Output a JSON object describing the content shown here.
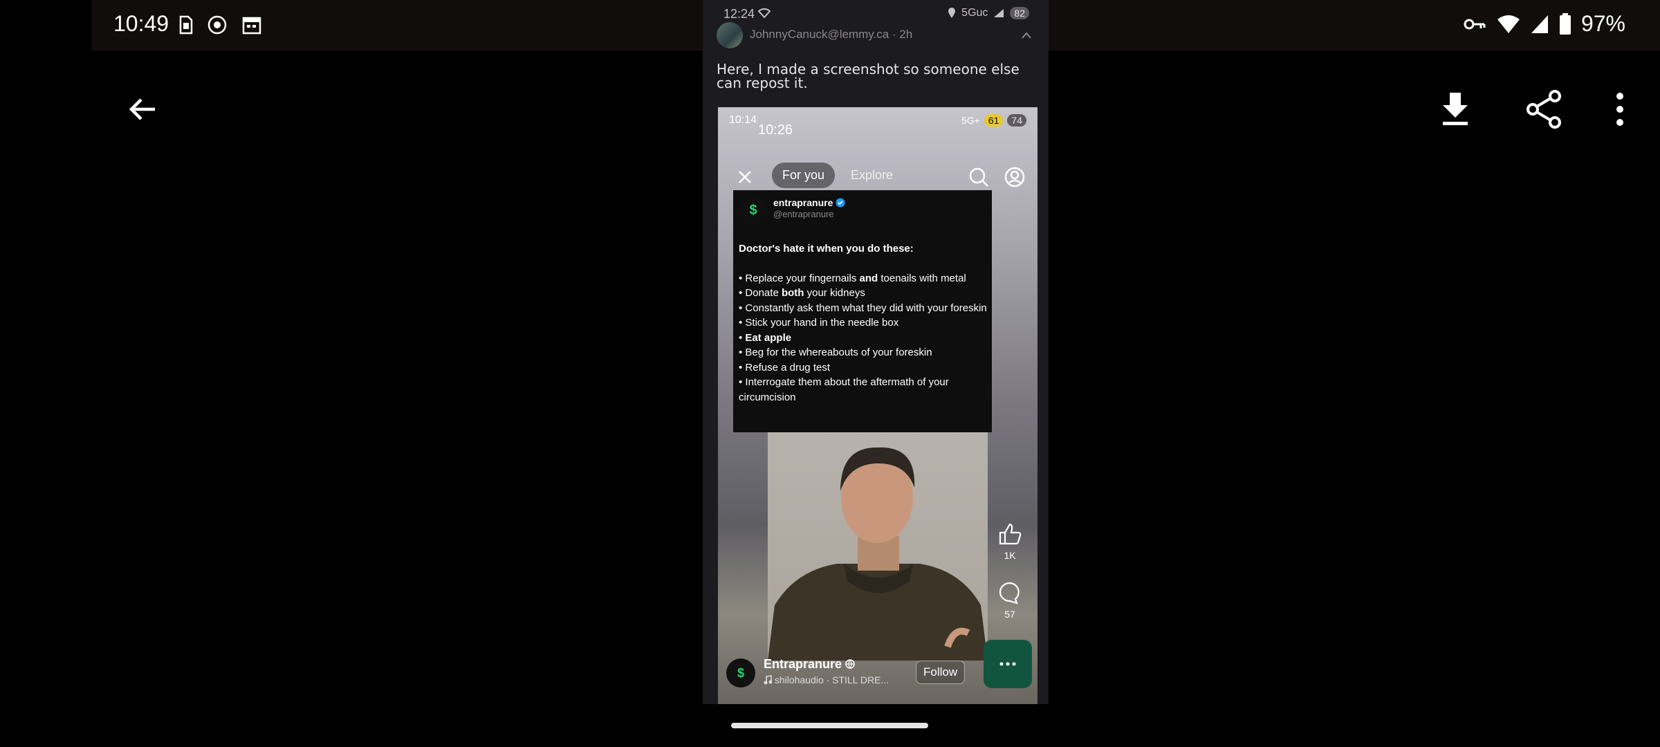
{
  "outer_status": {
    "time": "10:49",
    "battery": "97%",
    "icons": [
      "sim-card-icon",
      "vpn-globe-icon",
      "calendar-icon",
      "key-icon",
      "wifi-icon",
      "signal-icon",
      "battery-icon"
    ]
  },
  "toolbar": {
    "back_icon": "arrow-left-icon",
    "download_icon": "download-icon",
    "share_icon": "share-icon",
    "more_icon": "more-vert-icon"
  },
  "image": {
    "inner_status": {
      "time": "12:24",
      "network": "5Guc",
      "battery_badge": "82"
    },
    "comment": {
      "author": "JohnnyCanuck@lemmy.ca",
      "age": "2h",
      "text": "Here, I made a screenshot so someone else can repost it."
    },
    "phone": {
      "status_time": "10:14",
      "status_time_overlay": "10:26",
      "network": "5G+",
      "badge_a": "61",
      "badge_b": "74",
      "tabs": {
        "for_you": "For you",
        "explore": "Explore"
      },
      "tweet": {
        "avatar_glyph": "$",
        "name": "entrapranure",
        "handle": "@entrapranure",
        "headline": "Doctor's hate it when you do these:",
        "items": [
          [
            "• Replace your fingernails ",
            "and",
            " toenails with metal"
          ],
          [
            "• Donate ",
            "both",
            " your kidneys"
          ],
          [
            "• Constantly ask them what they did with your foreskin",
            "",
            ""
          ],
          [
            "• Stick your hand in the needle box",
            "",
            ""
          ],
          [
            "• ",
            "Eat apple",
            ""
          ],
          [
            "• Beg for the whereabouts of your foreskin",
            "",
            ""
          ],
          [
            "• Refuse a drug test",
            "",
            ""
          ],
          [
            "• Interrogate them about the aftermath of your circumcision",
            "",
            ""
          ]
        ]
      },
      "rail": {
        "likes": "1K",
        "comments": "57"
      },
      "channel": {
        "avatar_glyph": "$",
        "name": "Entrapranure",
        "audio": "shilohaudio · STILL DRE...",
        "follow_label": "Follow"
      }
    }
  },
  "colors": {
    "fab": "#12553f",
    "status_bg": "#120d0d",
    "verified": "#1d9bf0"
  }
}
